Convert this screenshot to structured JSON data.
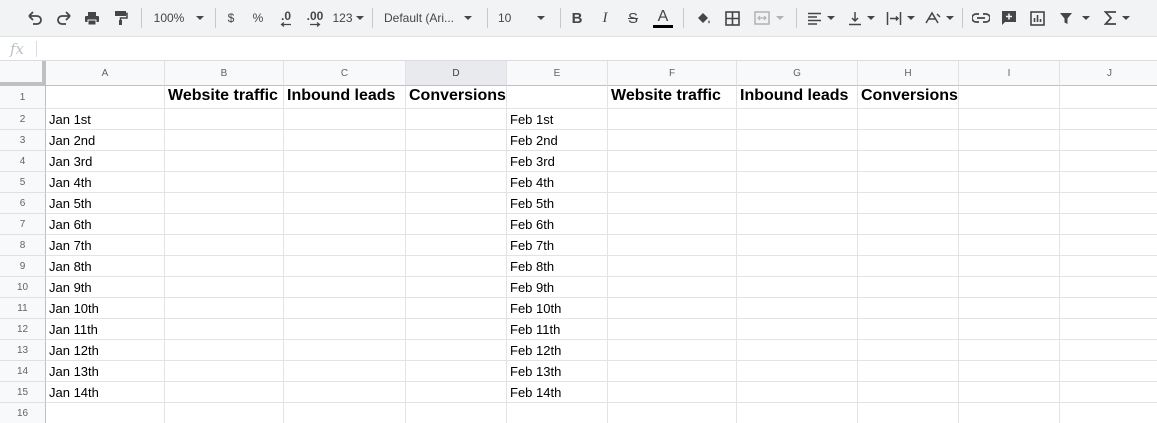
{
  "toolbar": {
    "zoom": "100%",
    "currency_label": "$",
    "percent_label": "%",
    "decimal_decrease_label": ".0",
    "decimal_increase_label": ".00",
    "more_formats_label": "123",
    "font_name": "Default (Ari...",
    "font_size": "10",
    "bold_label": "B",
    "italic_label": "I",
    "strike_label": "S",
    "text_color_label": "A",
    "icons": [
      "undo-icon",
      "redo-icon",
      "print-icon",
      "paint-format-icon",
      "fill-color-icon",
      "borders-icon",
      "merge-cells-icon",
      "align-horizontal-icon",
      "align-vertical-icon",
      "text-wrap-icon",
      "text-rotation-icon",
      "insert-link-icon",
      "insert-comment-icon",
      "insert-chart-icon",
      "filter-icon",
      "functions-icon"
    ],
    "text_color_swatch": "#000000"
  },
  "formula_bar": {
    "fx_label": "fx",
    "value": ""
  },
  "grid": {
    "columns": [
      "A",
      "B",
      "C",
      "D",
      "E",
      "F",
      "G",
      "H",
      "I",
      "J"
    ],
    "selected_column": "D",
    "rows": [
      "1",
      "2",
      "3",
      "4",
      "5",
      "6",
      "7",
      "8",
      "9",
      "10",
      "11",
      "12",
      "13",
      "14",
      "15",
      "16"
    ],
    "header_row": {
      "B": "Website traffic",
      "C": "Inbound leads",
      "D": "Conversions",
      "F": "Website traffic",
      "G": "Inbound leads",
      "H": "Conversions"
    },
    "col_a": [
      "Jan 1st",
      "Jan 2nd",
      "Jan 3rd",
      "Jan 4th",
      "Jan 5th",
      "Jan 6th",
      "Jan 7th",
      "Jan 8th",
      "Jan 9th",
      "Jan 10th",
      "Jan 11th",
      "Jan 12th",
      "Jan 13th",
      "Jan 14th"
    ],
    "col_e": [
      "Feb 1st",
      "Feb 2nd",
      "Feb 3rd",
      "Feb 4th",
      "Feb 5th",
      "Feb 6th",
      "Feb 7th",
      "Feb 8th",
      "Feb 9th",
      "Feb 10th",
      "Feb 11th",
      "Feb 12th",
      "Feb 13th",
      "Feb 14th"
    ]
  }
}
